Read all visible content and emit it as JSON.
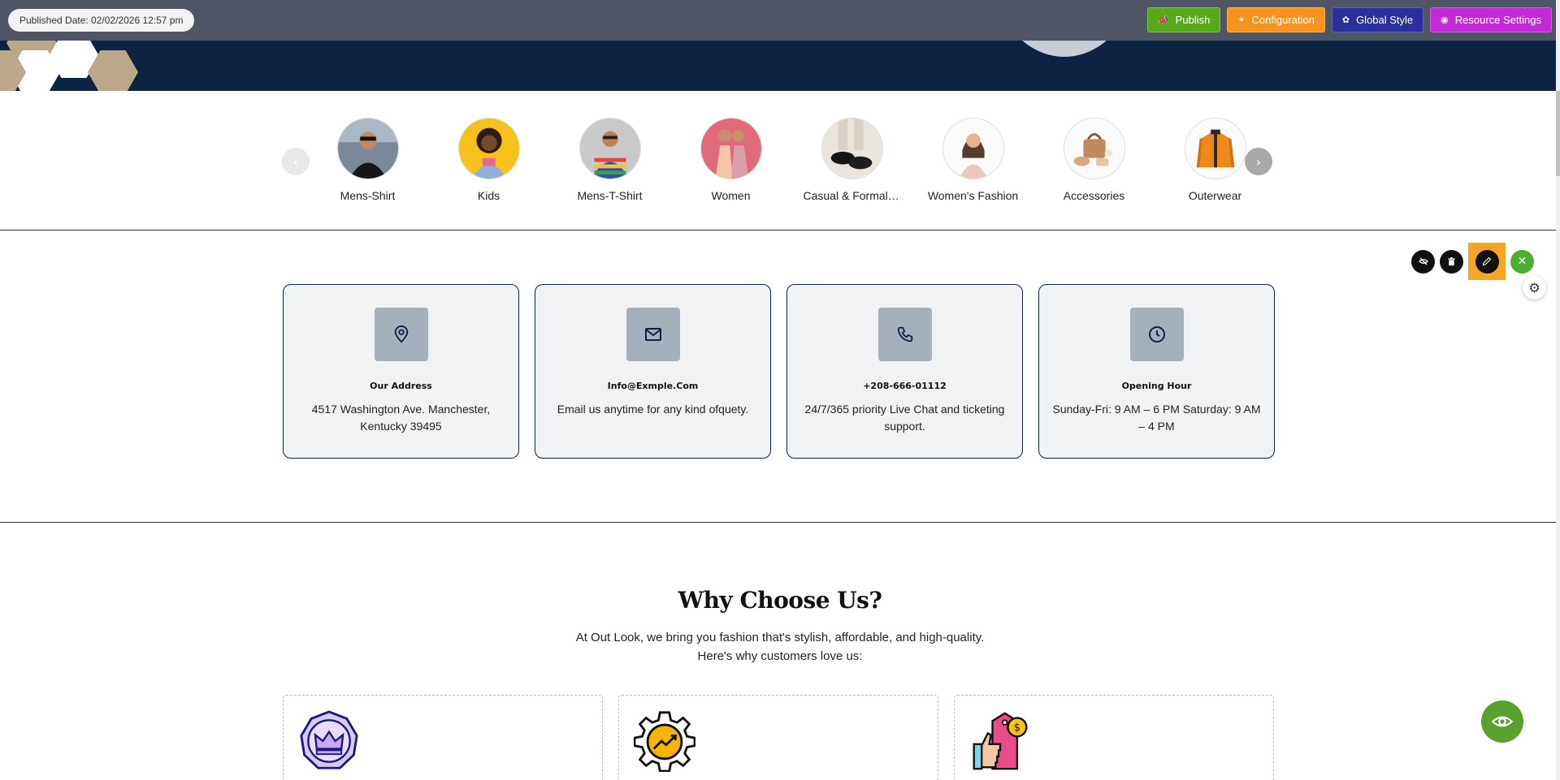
{
  "topbar": {
    "published_date": "Published Date: 02/02/2026 12:57 pm",
    "buttons": [
      {
        "label": "Publish",
        "icon": "megaphone-icon",
        "color": "#58a81c"
      },
      {
        "label": "Configuration",
        "icon": "sparkle-icon",
        "color": "#f7941d"
      },
      {
        "label": "Global Style",
        "icon": "palette-icon",
        "color": "#2a2f9c"
      },
      {
        "label": "Resource Settings",
        "icon": "globe-icon",
        "color": "#c42bd6"
      }
    ]
  },
  "categories": {
    "items": [
      {
        "label": "Mens-Shirt"
      },
      {
        "label": "Kids"
      },
      {
        "label": "Mens-T-Shirt"
      },
      {
        "label": "Women"
      },
      {
        "label": "Casual & Formal Shoes"
      },
      {
        "label": "Women's Fashion"
      },
      {
        "label": "Accessories"
      },
      {
        "label": "Outerwear"
      }
    ]
  },
  "contact": {
    "cards": [
      {
        "icon": "map-pin-icon",
        "title": "Our Address",
        "text": "4517 Washington Ave. Manchester, Kentucky 39495"
      },
      {
        "icon": "mail-icon",
        "title": "Info@Exmple.Com",
        "text": "Email us anytime for any kind ofquety."
      },
      {
        "icon": "phone-icon",
        "title": "+208-666-01112",
        "text": "24/7/365 priority Live Chat and ticketing support."
      },
      {
        "icon": "clock-icon",
        "title": "Opening Hour",
        "text": "Sunday-Fri: 9 AM – 6 PM Saturday: 9 AM – 4 PM"
      }
    ]
  },
  "why": {
    "title": "Why Choose Us?",
    "subtitle_line1": "At Out Look, we bring you fashion that's stylish, affordable, and high-quality.",
    "subtitle_line2": "Here's why customers love us:"
  }
}
